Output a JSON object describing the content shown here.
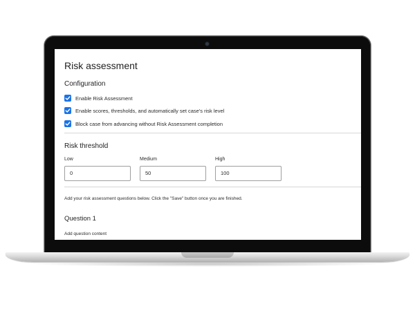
{
  "page": {
    "title": "Risk assessment",
    "configuration_heading": "Configuration",
    "checkboxes": [
      {
        "label": "Enable Risk Assessment",
        "checked": true
      },
      {
        "label": "Enable scores, thresholds, and automatically set case's risk level",
        "checked": true
      },
      {
        "label": "Block case from advancing without Risk Assessment completion",
        "checked": true
      }
    ],
    "threshold_heading": "Risk threshold",
    "thresholds": [
      {
        "label": "Low",
        "value": "0"
      },
      {
        "label": "Medium",
        "value": "50"
      },
      {
        "label": "High",
        "value": "100"
      }
    ],
    "hint": "Add your risk assessment questions below. Click the \"Save\" button once you are finished.",
    "question_title": "Question 1",
    "question_subtitle": "Add question content"
  },
  "colors": {
    "checkbox_accent": "#1a73e8",
    "bezel": "#0c0c0c",
    "screen_bg": "#ffffff"
  },
  "icons": {
    "checkbox_mark": "checkmark-icon",
    "camera": "camera-icon"
  }
}
